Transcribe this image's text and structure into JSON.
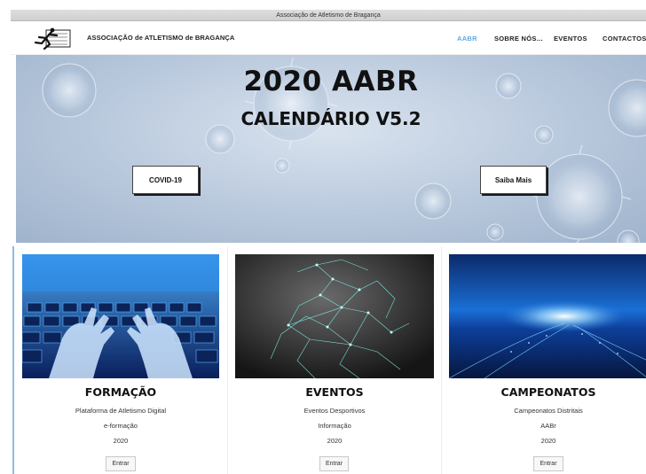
{
  "window": {
    "title": "Associação de Atletismo de Bragança"
  },
  "header": {
    "brand": "ASSOCIAÇÃO de ATLETISMO de BRAGANÇA",
    "nav": [
      {
        "label": "AABR",
        "active": true
      },
      {
        "label": "SOBRE NÓS...",
        "active": false
      },
      {
        "label": "EVENTOS",
        "active": false
      },
      {
        "label": "CONTACTOS",
        "active": false
      }
    ]
  },
  "hero": {
    "title": "2020 AABR",
    "subtitle": "CALENDÁRIO V5.2",
    "button_left": "COVID-19",
    "button_right": "Saiba Mais"
  },
  "cards": [
    {
      "title": "FORMAÇÃO",
      "lines": [
        "Plataforma de Atletismo Digital",
        "e-formação",
        "2020"
      ],
      "button": "Entrar",
      "image": "keyboard-hands-image"
    },
    {
      "title": "EVENTOS",
      "lines": [
        "Eventos Desportivos",
        "Informação",
        "2020"
      ],
      "button": "Entrar",
      "image": "network-runner-image"
    },
    {
      "title": "CAMPEONATOS",
      "lines": [
        "Campeonatos Distritais",
        "AABr",
        "2020"
      ],
      "button": "Entrar",
      "image": "digital-road-image"
    }
  ],
  "colors": {
    "accent": "#5fa8e6",
    "text": "#111111",
    "card_border": "#8fbbe8"
  }
}
